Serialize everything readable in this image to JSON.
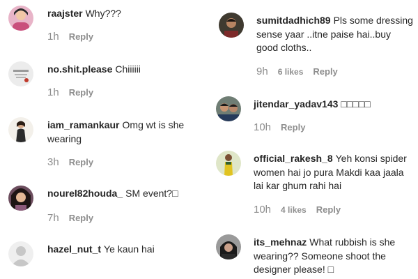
{
  "left_comments": [
    {
      "username": "raajster",
      "text": "Why???",
      "time": "1h",
      "likes": "",
      "reply": "Reply",
      "avatar_color": "#c94f7c"
    },
    {
      "username": "no.shit.please",
      "text": "Chiiiiii",
      "time": "1h",
      "likes": "",
      "reply": "Reply",
      "avatar_color": "#d9d9d9"
    },
    {
      "username": "iam_ramankaur",
      "text": "Omg wt is she wearing",
      "time": "3h",
      "likes": "",
      "reply": "Reply",
      "avatar_color": "#b08b6e"
    },
    {
      "username": "nourel82houda_",
      "text": "SM event?□",
      "time": "7h",
      "likes": "",
      "reply": "Reply",
      "avatar_color": "#7a5a6a"
    },
    {
      "username": "hazel_nut_t",
      "text": "Ye kaun hai",
      "time": "",
      "likes": "",
      "reply": "",
      "avatar_color": "#dbdbdb"
    }
  ],
  "right_comments": [
    {
      "username": "sumitdadhich89",
      "text": "Pls some dressing sense yaar ..itne paise hai..buy good cloths..",
      "time": "9h",
      "likes": "6 likes",
      "reply": "Reply",
      "avatar_color": "#5a4a3a"
    },
    {
      "username": "jitendar_yadav143",
      "text": "□□□□□",
      "time": "10h",
      "likes": "",
      "reply": "Reply",
      "avatar_color": "#4a5a4a"
    },
    {
      "username": "official_rakesh_8",
      "text": "Yeh konsi spider women hai jo pura Makdi kaa jaala lai kar ghum rahi hai",
      "time": "10h",
      "likes": "4 likes",
      "reply": "Reply",
      "avatar_color": "#9aa23a"
    },
    {
      "username": "its_mehnaz",
      "text": "What rubbish is she wearing?? Someone shoot the designer please! □",
      "time": "",
      "likes": "",
      "reply": "",
      "avatar_color": "#3a3a3a"
    }
  ]
}
